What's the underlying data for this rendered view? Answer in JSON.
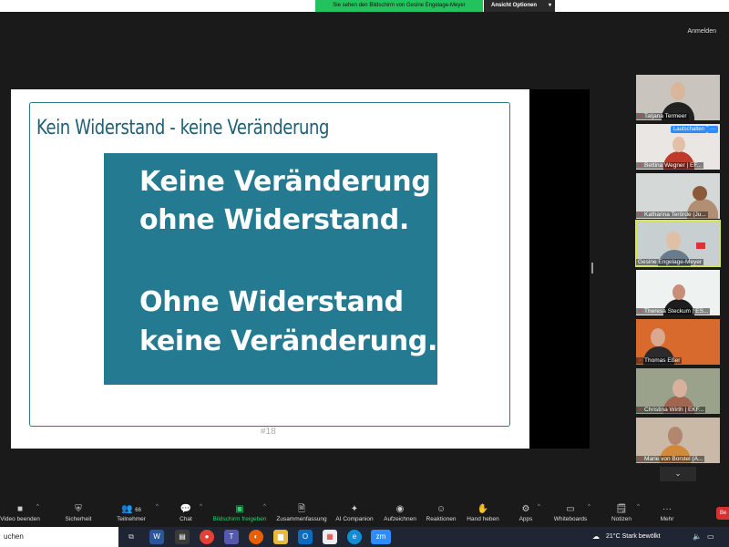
{
  "banner": {
    "sharing_text": "Sie sehen den Bildschirm von Gesine Engelage-Meyer",
    "view_options": "Ansicht Optionen"
  },
  "header": {
    "login": "Anmelden"
  },
  "slide": {
    "title": "Kein Widerstand - keine Veränderung",
    "lines": [
      "Keine Veränderung",
      "ohne Widerstand.",
      "Ohne Widerstand",
      "keine Veränderung."
    ],
    "page_number": "#18",
    "accent_color": "#247a91"
  },
  "participants": [
    {
      "name": "Tatjana Termeer"
    },
    {
      "name": "Bettina Wegner | EF...",
      "unmute_label": "Lautschalten",
      "more_label": "···"
    },
    {
      "name": "Katharina Terörde (Ju..."
    },
    {
      "name": "Gesine Engelage-Meyer"
    },
    {
      "name": "Theresa Steckum | ES..."
    },
    {
      "name": "Thomas Eßer"
    },
    {
      "name": "Christina Wirth | EKF..."
    },
    {
      "name": "Marie von Borstel (A..."
    }
  ],
  "toolbar": [
    {
      "label": "Video beenden",
      "icon": "video-icon"
    },
    {
      "label": "Sicherheit",
      "icon": "shield-icon"
    },
    {
      "label": "Teilnehmer",
      "count": "66",
      "icon": "people-icon"
    },
    {
      "label": "Chat",
      "icon": "chat-icon"
    },
    {
      "label": "Bildschirm freigeben",
      "icon": "share-screen-icon"
    },
    {
      "label": "Zusammenfassung",
      "icon": "summary-icon"
    },
    {
      "label": "AI Companion",
      "icon": "sparkle-icon"
    },
    {
      "label": "Aufzeichnen",
      "icon": "record-icon"
    },
    {
      "label": "Reaktionen",
      "icon": "reaction-icon"
    },
    {
      "label": "Hand heben",
      "icon": "hand-icon"
    },
    {
      "label": "Apps",
      "icon": "apps-icon"
    },
    {
      "label": "Whiteboards",
      "icon": "whiteboard-icon"
    },
    {
      "label": "Notizen",
      "icon": "notes-icon"
    },
    {
      "label": "Mehr",
      "icon": "more-icon"
    }
  ],
  "end_button": "Be",
  "taskbar": {
    "search_text": "uchen",
    "weather": "21°C  Stark bewölkt"
  }
}
